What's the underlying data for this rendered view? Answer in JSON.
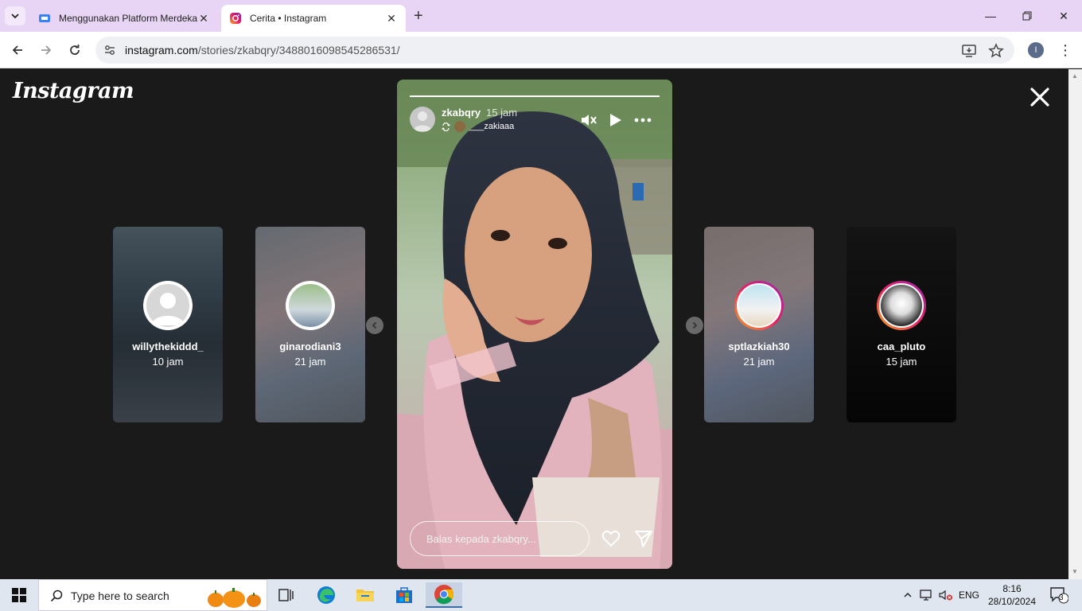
{
  "browser": {
    "tabs": [
      {
        "title": "Menggunakan Platform Merdeka",
        "active": false
      },
      {
        "title": "Cerita • Instagram",
        "active": true
      }
    ],
    "url_host": "instagram.com",
    "url_path": "/stories/zkabqry/3488016098545286531/",
    "profile_initial": "I"
  },
  "instagram": {
    "logo": "Instagram",
    "story": {
      "username": "zkabqry",
      "time": "15 jam",
      "reposted_from": "___zakiaaa",
      "progress": 1.0,
      "reply_placeholder": "Balas kepada zkabqry..."
    },
    "side_stories": [
      {
        "username": "willythekiddd_",
        "time": "10 jam"
      },
      {
        "username": "ginarodiani3",
        "time": "21 jam"
      },
      {
        "username": "sptlazkiah30",
        "time": "21 jam"
      },
      {
        "username": "caa_pluto",
        "time": "15 jam"
      }
    ]
  },
  "taskbar": {
    "search_placeholder": "Type here to search",
    "language": "ENG",
    "time": "8:16",
    "date": "28/10/2024",
    "notifications": "3"
  },
  "colors": {
    "tabbar": "#e8d5f5",
    "viewer_bg": "#1a1a1a",
    "story_ring_start": "#f9a825",
    "story_ring_end": "#c2185b"
  }
}
